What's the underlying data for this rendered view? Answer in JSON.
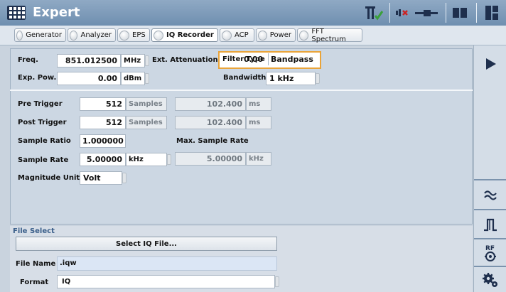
{
  "window": {
    "title": "Expert"
  },
  "tabs": [
    {
      "label": "Generator"
    },
    {
      "label": "Analyzer"
    },
    {
      "label": "EPS"
    },
    {
      "label": "IQ Recorder"
    },
    {
      "label": "ACP"
    },
    {
      "label": "Power"
    },
    {
      "label": "FFT Spectrum"
    }
  ],
  "active_tab": "IQ Recorder",
  "top_section": {
    "freq": {
      "label": "Freq.",
      "value": "851.012500",
      "unit": "MHz"
    },
    "exp_pow": {
      "label": "Exp. Pow.",
      "value": "0.00",
      "unit": "dBm"
    },
    "ext_attenuation": {
      "label": "Ext. Attenuation",
      "value": "0.00"
    },
    "filter_type": {
      "label": "Filter Type",
      "value": "Bandpass"
    },
    "bandwidth": {
      "label": "Bandwidth",
      "value": "1 kHz"
    }
  },
  "trigger_section": {
    "pre_trigger": {
      "label": "Pre Trigger",
      "samples": "512",
      "samples_unit": "Samples",
      "time": "102.400",
      "time_unit": "ms"
    },
    "post_trigger": {
      "label": "Post Trigger",
      "samples": "512",
      "samples_unit": "Samples",
      "time": "102.400",
      "time_unit": "ms"
    },
    "sample_ratio": {
      "label": "Sample Ratio",
      "value": "1.000000"
    },
    "max_sample_rate": {
      "label": "Max. Sample Rate",
      "value": "5.00000",
      "unit": "kHz"
    },
    "sample_rate": {
      "label": "Sample Rate",
      "value": "5.00000",
      "unit": "kHz"
    },
    "magnitude_unit": {
      "label": "Magnitude Unit",
      "value": "Volt"
    }
  },
  "file_select": {
    "title": "File Select",
    "button_label": "Select IQ File...",
    "file_name_label": "File Name",
    "file_name_value": ".iqw",
    "format_label": "Format",
    "format_value": "IQ"
  },
  "icons": {
    "menu": "grid-menu-icon",
    "trigger_status": "trigger-check-icon",
    "mute": "speaker-mute-icon",
    "slider": "volume-slider-icon",
    "book": "book-icon",
    "layout": "layout-split-icon",
    "run": "play-icon",
    "filter": "tilde-filter-icon",
    "pulse": "pulse-icon",
    "rf": "rf-connector-icon",
    "settings": "gears-icon"
  },
  "colors": {
    "titlebar": "#7d98b8",
    "accent_orange": "#e9a43a",
    "mute_red": "#cc2222",
    "check_green": "#3aa03a"
  }
}
